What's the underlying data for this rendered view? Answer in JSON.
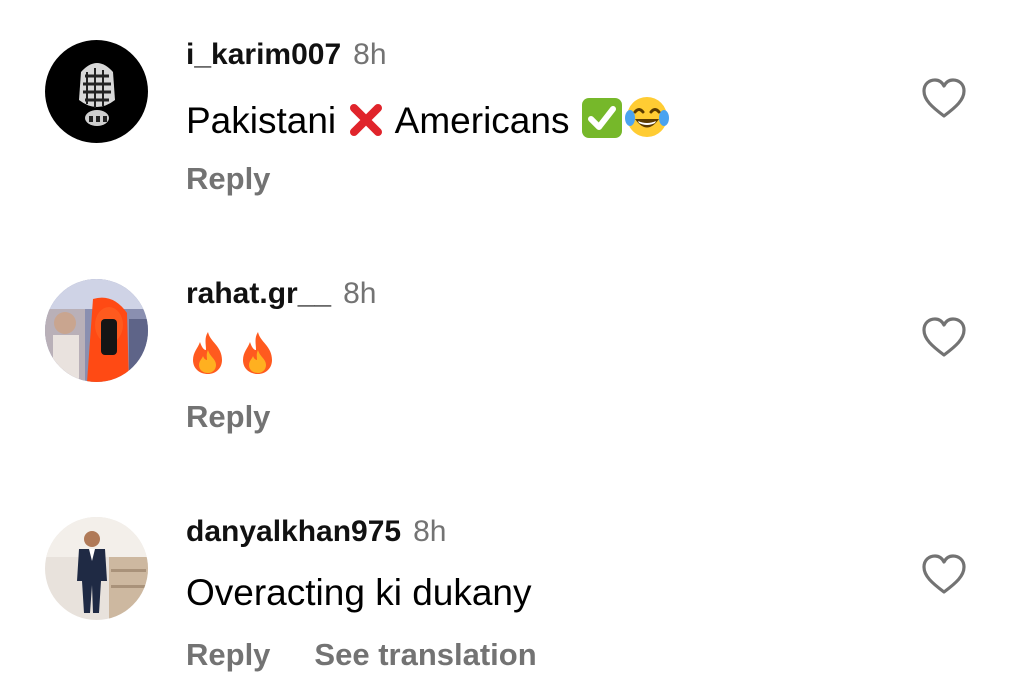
{
  "comments": [
    {
      "username": "i_karim007",
      "time": "8h",
      "text_before": "Pakistani",
      "emoji_cross": "cross-mark-emoji",
      "text_middle": "Americans",
      "emoji_check": "check-mark-emoji",
      "emoji_laugh": "tears-of-joy-emoji",
      "reply_label": "Reply",
      "avatar": "keffiyeh-skull-avatar",
      "like_icon": "heart-outline-icon"
    },
    {
      "username": "rahat.gr__",
      "time": "8h",
      "emoji_fire": "fire-emoji",
      "reply_label": "Reply",
      "avatar": "selfie-avatar",
      "like_icon": "heart-outline-icon"
    },
    {
      "username": "danyalkhan975",
      "time": "8h",
      "text": "Overacting ki dukany",
      "reply_label": "Reply",
      "translation_label": "See translation",
      "avatar": "suit-man-avatar",
      "like_icon": "heart-outline-icon"
    }
  ],
  "colors": {
    "secondary_text": "#737373",
    "primary_text": "#000000",
    "cross_red": "#e0242b",
    "check_green": "#76b82a"
  }
}
